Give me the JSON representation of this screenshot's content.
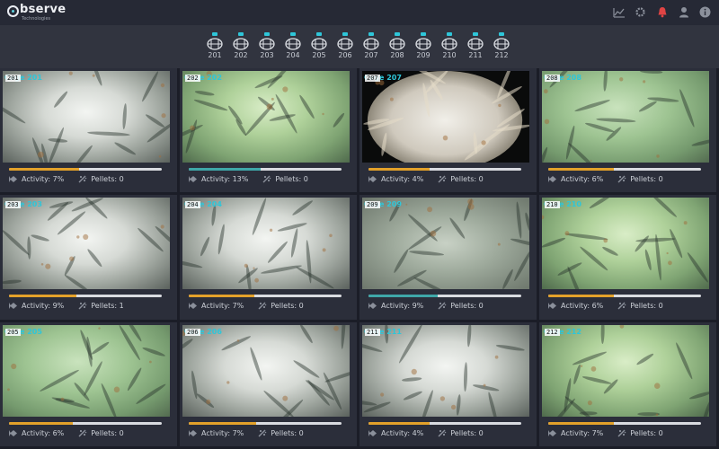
{
  "app": {
    "logo_word": "bserve",
    "logo_sub": "Technologies"
  },
  "top_icons": [
    "chart-line-icon",
    "gear-icon",
    "bell-icon",
    "user-icon",
    "info-icon"
  ],
  "colors": {
    "accent": "#2ec6d9",
    "activity_orange": "#e3a12a",
    "activity_teal": "#3fa7a8",
    "bell_red": "#e04444"
  },
  "cameras": [
    "201",
    "202",
    "203",
    "204",
    "205",
    "206",
    "207",
    "208",
    "209",
    "210",
    "211",
    "212"
  ],
  "tiles": [
    {
      "label": "Cage 201",
      "badge": "201",
      "activity_label": "Activity: 7%",
      "activity": 0.46,
      "bar_color": "#e3a12a",
      "pellets_label": "Pellets: 0",
      "scene": "bright"
    },
    {
      "label": "Cage 202",
      "badge": "202",
      "activity_label": "Activity: 13%",
      "activity": 0.47,
      "bar_color": "#3fa7a8",
      "pellets_label": "Pellets: 0",
      "scene": "green"
    },
    {
      "label": "Cage 207",
      "badge": "207",
      "activity_label": "Activity: 4%",
      "activity": 0.4,
      "bar_color": "#e3a12a",
      "pellets_label": "Pellets: 0",
      "scene": "dark"
    },
    {
      "label": "Cage 208",
      "badge": "208",
      "activity_label": "Activity: 6%",
      "activity": 0.43,
      "bar_color": "#e3a12a",
      "pellets_label": "Pellets: 0",
      "scene": "green2"
    },
    {
      "label": "Cage 203",
      "badge": "203",
      "activity_label": "Activity: 9%",
      "activity": 0.44,
      "bar_color": "#e3a12a",
      "pellets_label": "Pellets: 1",
      "scene": "bright"
    },
    {
      "label": "Cage 204",
      "badge": "204",
      "activity_label": "Activity: 7%",
      "activity": 0.43,
      "bar_color": "#e3a12a",
      "pellets_label": "Pellets: 0",
      "scene": "bright"
    },
    {
      "label": "Cage 209",
      "badge": "209",
      "activity_label": "Activity: 9%",
      "activity": 0.45,
      "bar_color": "#3fa7a8",
      "pellets_label": "Pellets: 0",
      "scene": "grey"
    },
    {
      "label": "Cage 210",
      "badge": "210",
      "activity_label": "Activity: 6%",
      "activity": 0.43,
      "bar_color": "#e3a12a",
      "pellets_label": "Pellets: 0",
      "scene": "green"
    },
    {
      "label": "Cage 205",
      "badge": "205",
      "activity_label": "Activity: 6%",
      "activity": 0.42,
      "bar_color": "#e3a12a",
      "pellets_label": "Pellets: 0",
      "scene": "green2"
    },
    {
      "label": "Cage 206",
      "badge": "206",
      "activity_label": "Activity: 7%",
      "activity": 0.44,
      "bar_color": "#e3a12a",
      "pellets_label": "Pellets: 0",
      "scene": "bright"
    },
    {
      "label": "Cage 211",
      "badge": "211",
      "activity_label": "Activity: 4%",
      "activity": 0.4,
      "bar_color": "#e3a12a",
      "pellets_label": "Pellets: 0",
      "scene": "bright"
    },
    {
      "label": "Cage 212",
      "badge": "212",
      "activity_label": "Activity: 7%",
      "activity": 0.43,
      "bar_color": "#e3a12a",
      "pellets_label": "Pellets: 0",
      "scene": "green"
    }
  ]
}
